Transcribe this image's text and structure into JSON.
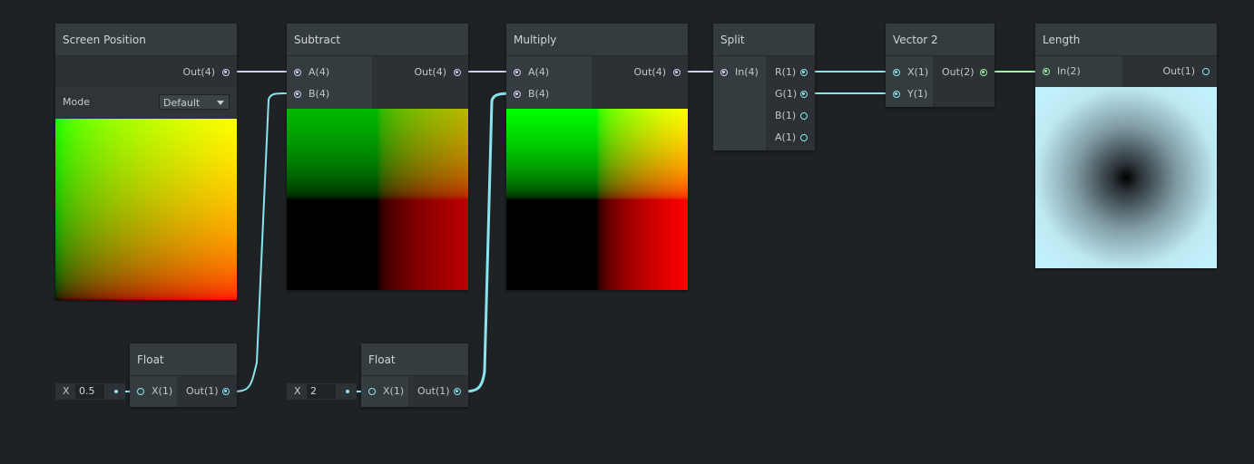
{
  "colors": {
    "background": "#1e2224",
    "wire_vector4": "#d6cff0",
    "wire_vector1": "#8ae4ee",
    "wire_vector2": "#9ef2a6"
  },
  "nodes": {
    "screen_position": {
      "title": "Screen Position",
      "out": "Out(4)",
      "mode_label": "Mode",
      "mode_value": "Default"
    },
    "subtract": {
      "title": "Subtract",
      "in_a": "A(4)",
      "in_b": "B(4)",
      "out": "Out(4)"
    },
    "multiply": {
      "title": "Multiply",
      "in_a": "A(4)",
      "in_b": "B(4)",
      "out": "Out(4)"
    },
    "split": {
      "title": "Split",
      "in": "In(4)",
      "out_r": "R(1)",
      "out_g": "G(1)",
      "out_b": "B(1)",
      "out_a": "A(1)"
    },
    "vector2": {
      "title": "Vector 2",
      "in_x": "X(1)",
      "in_y": "Y(1)",
      "out": "Out(2)"
    },
    "length": {
      "title": "Length",
      "in": "In(2)",
      "out": "Out(1)"
    },
    "float1": {
      "title": "Float",
      "in_x": "X(1)",
      "out": "Out(1)",
      "field_label": "X",
      "field_value": "0.5"
    },
    "float2": {
      "title": "Float",
      "in_x": "X(1)",
      "out": "Out(1)",
      "field_label": "X",
      "field_value": "2"
    }
  }
}
